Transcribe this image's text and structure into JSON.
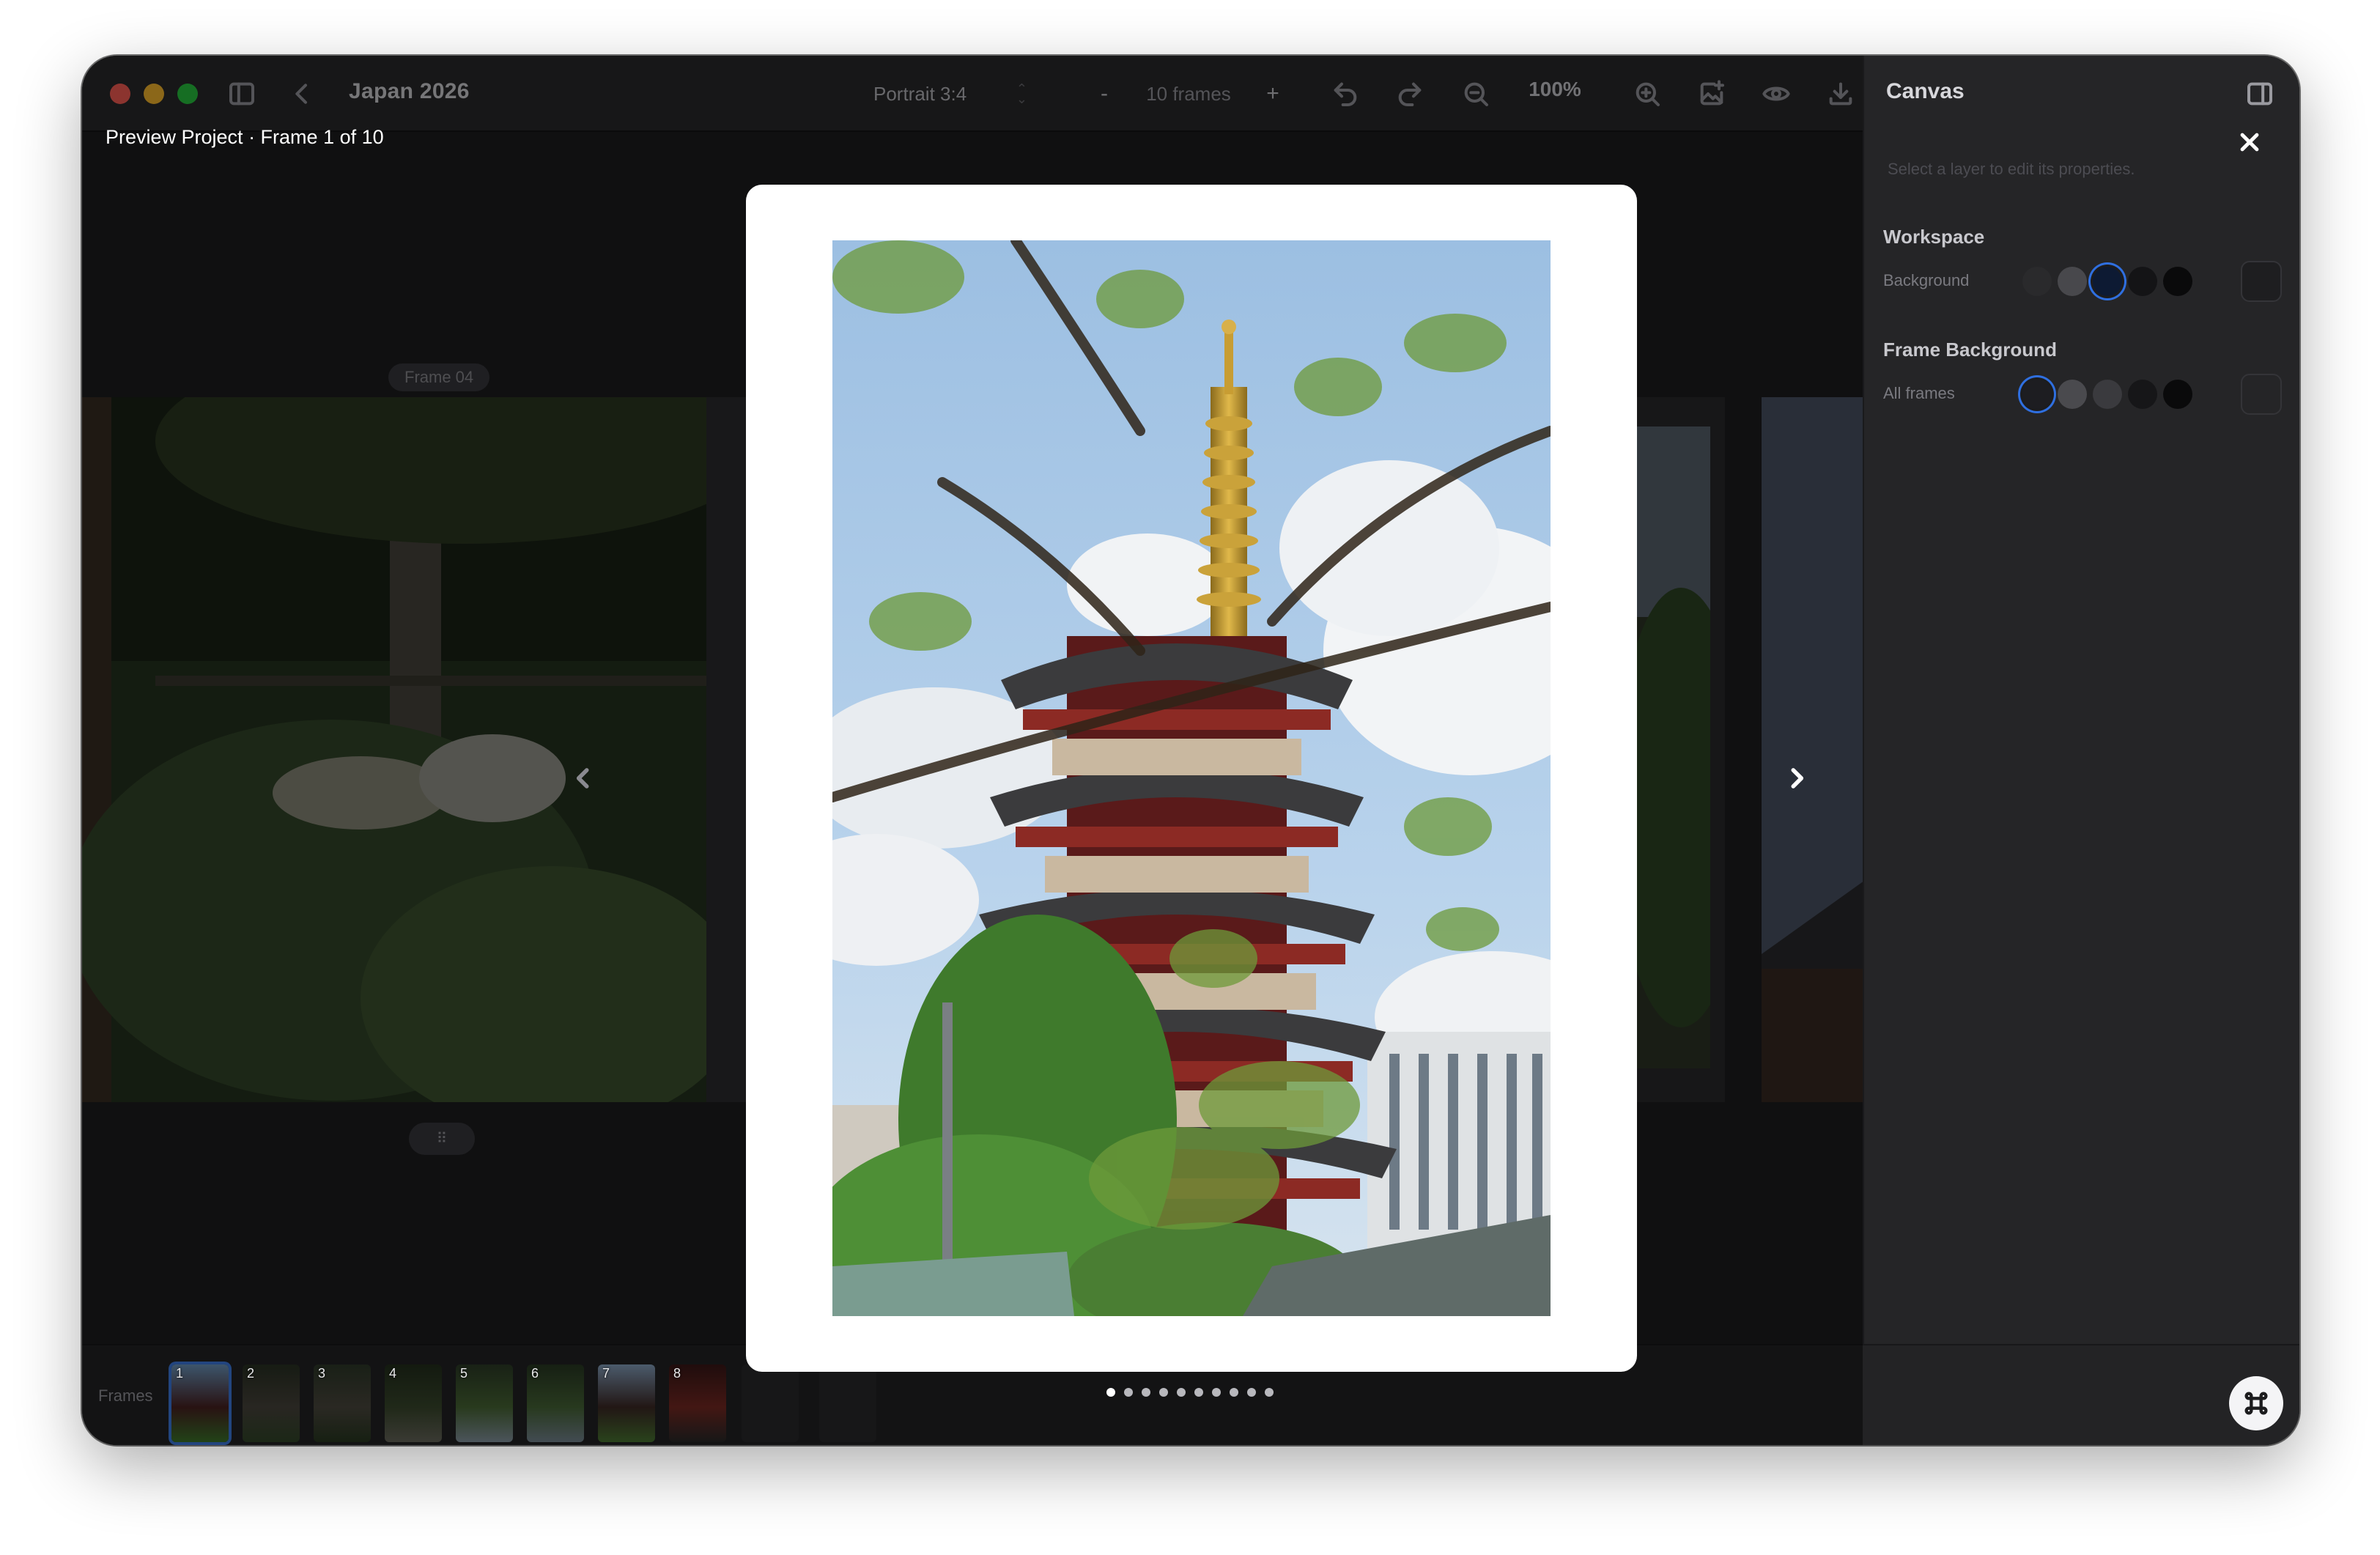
{
  "window": {
    "project_title": "Japan 2026",
    "format": "Portrait 3:4",
    "frames_count_label": "10 frames",
    "zoom": "100%",
    "decrement_label": "-",
    "increment_label": "+"
  },
  "toolbar_icons": [
    "sidebar-icon",
    "back-chevron-icon",
    "undo-icon",
    "redo-icon",
    "zoom-out-icon",
    "zoom-in-icon",
    "add-image-icon",
    "eye-icon",
    "download-icon",
    "inspector-toggle-icon"
  ],
  "inspector": {
    "title": "Canvas",
    "hint": "Select a layer to edit its properties.",
    "workspace": {
      "title": "Workspace",
      "row_label": "Background",
      "swatches": [
        "#2a2a2c",
        "#48484c",
        "#0d1a33",
        "#141416",
        "#0a0a0b"
      ],
      "selected_index": 2
    },
    "frame_background": {
      "title": "Frame Background",
      "row_label": "All frames",
      "swatches": [
        "#1d1d21",
        "#4a4a4e",
        "#3a3a3e",
        "#161618",
        "#0a0a0b"
      ],
      "selected_index": 0
    }
  },
  "workspace": {
    "frame_tag": "Frame 04",
    "drag_handle": "⠿"
  },
  "strip": {
    "label": "Frames",
    "thumbs": [
      "1",
      "2",
      "3",
      "4",
      "5",
      "6",
      "7",
      "8"
    ]
  },
  "preview": {
    "label": "Preview Project · Frame 1 of 10",
    "total_dots": 10,
    "active_dot": 0
  }
}
